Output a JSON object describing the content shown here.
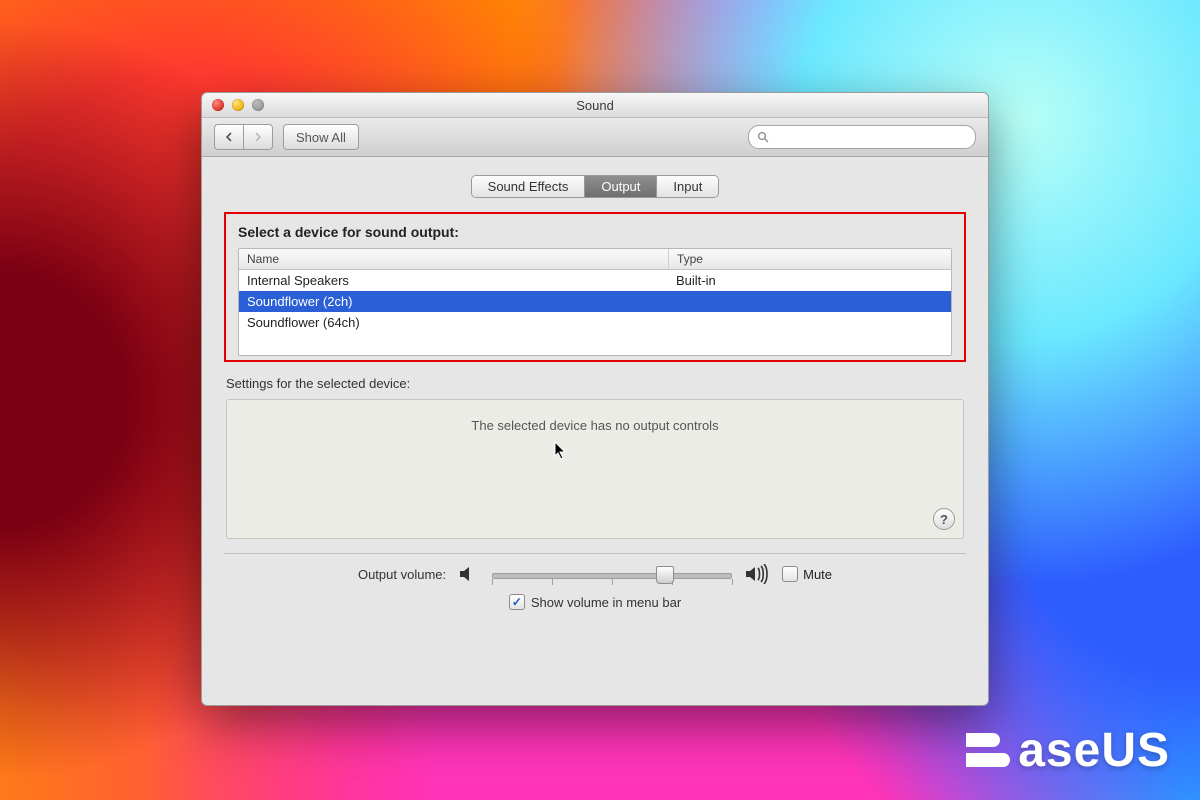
{
  "window": {
    "title": "Sound"
  },
  "toolbar": {
    "show_all": "Show All",
    "search_placeholder": ""
  },
  "tabs": [
    {
      "label": "Sound Effects",
      "active": false
    },
    {
      "label": "Output",
      "active": true
    },
    {
      "label": "Input",
      "active": false
    }
  ],
  "section": {
    "title": "Select a device for sound output:",
    "columns": {
      "name": "Name",
      "type": "Type"
    },
    "devices": [
      {
        "name": "Internal Speakers",
        "type": "Built-in",
        "selected": false
      },
      {
        "name": "Soundflower (2ch)",
        "type": "",
        "selected": true
      },
      {
        "name": "Soundflower (64ch)",
        "type": "",
        "selected": false
      }
    ]
  },
  "settings": {
    "subtitle": "Settings for the selected device:",
    "message": "The selected device has no output controls"
  },
  "volume": {
    "label": "Output volume:",
    "value_percent": 72,
    "mute_label": "Mute",
    "mute_checked": false,
    "show_in_menu_label": "Show volume in menu bar",
    "show_in_menu_checked": true
  },
  "branding": {
    "text": "aseUS"
  }
}
